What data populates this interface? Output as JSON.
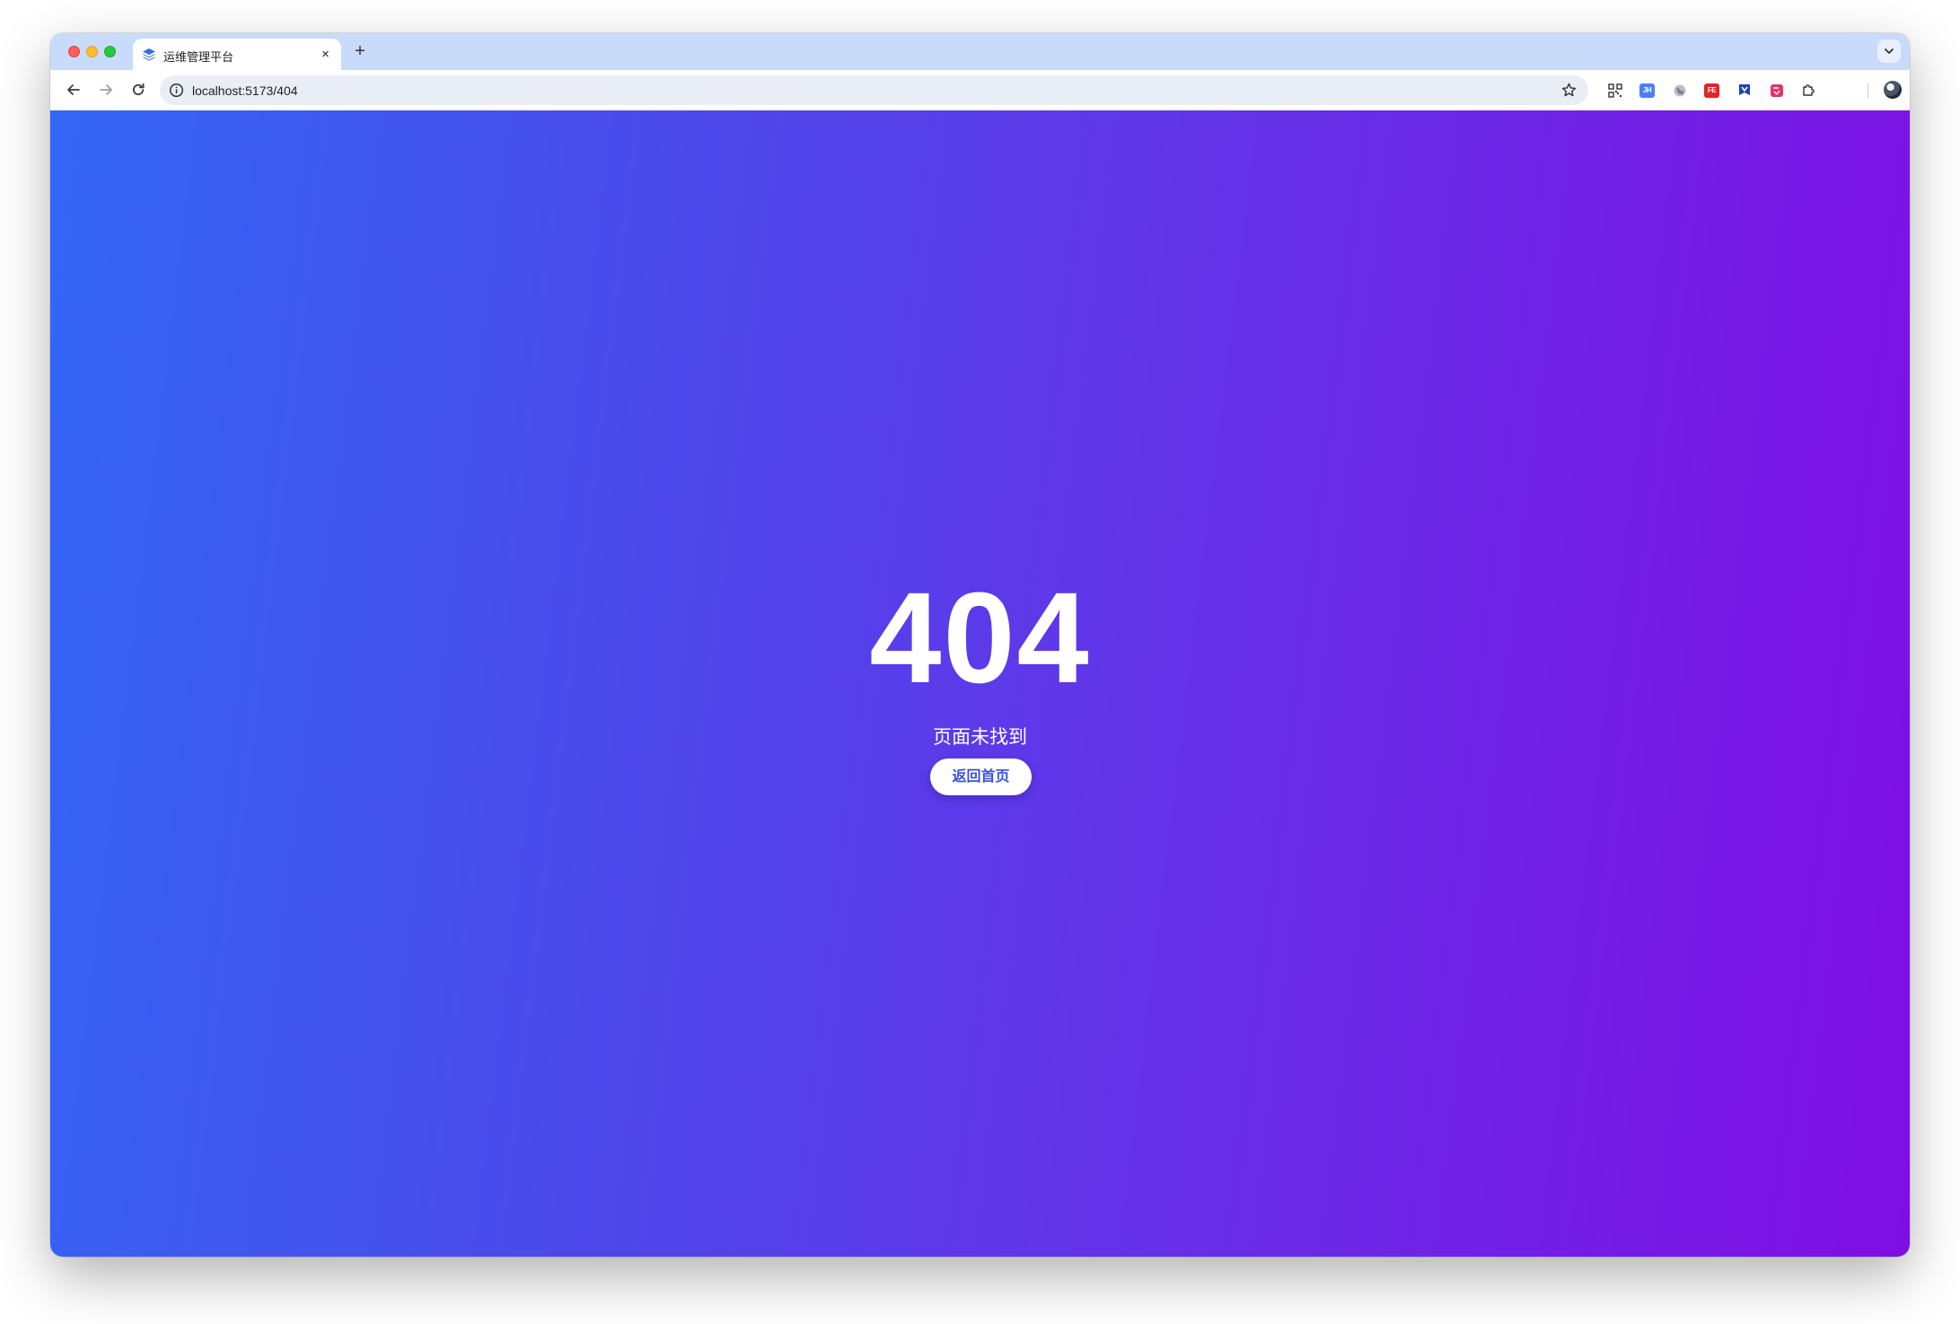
{
  "browser": {
    "tab": {
      "title": "运维管理平台",
      "close_glyph": "×",
      "favicon": "layers-icon"
    },
    "new_tab_glyph": "+",
    "address_bar": {
      "url": "localhost:5173/404"
    },
    "extensions": [
      {
        "name": "qr-code-extension-icon",
        "label": ""
      },
      {
        "name": "jh-extension-icon",
        "label": "JH",
        "color": "#4d7ef7"
      },
      {
        "name": "globe-extension-icon",
        "label": ""
      },
      {
        "name": "fe-extension-icon",
        "label": "FE",
        "color": "#e0242c"
      },
      {
        "name": "blue-extension-icon",
        "label": "",
        "color": "#1f3fbf"
      },
      {
        "name": "translate-extension-icon",
        "label": "",
        "color": "#e0356b"
      },
      {
        "name": "puzzle-extensions-icon",
        "label": ""
      }
    ]
  },
  "page": {
    "error_code": "404",
    "message": "页面未找到",
    "home_button_label": "返回首页",
    "gradient": [
      "#3366f5",
      "#4a4beb",
      "#6630e8",
      "#7f0ee5"
    ]
  }
}
